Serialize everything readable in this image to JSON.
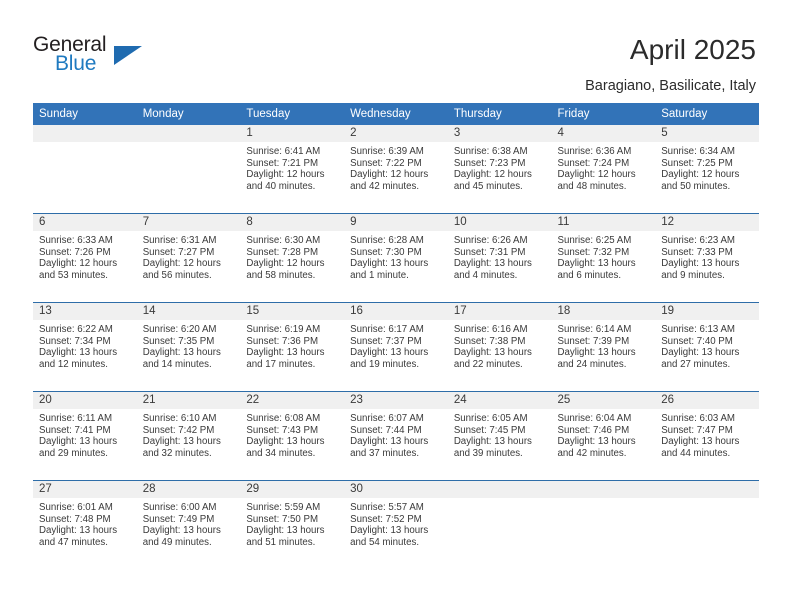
{
  "brand": {
    "word_one": "General",
    "word_two": "Blue",
    "triangle_icon": "triangle-logo-mark",
    "colors": {
      "dark": "#231f20",
      "blue": "#1f7ac0",
      "triangle": "#1f6bb0"
    }
  },
  "header": {
    "title": "April 2025",
    "subtitle": "Baragiano, Basilicate, Italy"
  },
  "theme": {
    "header_blue": "#3273b8",
    "row_divider_blue": "#2e6da8",
    "daynum_band_gray": "#f0f0f0",
    "text": "#3a3a3a"
  },
  "calendar": {
    "weekdays": [
      "Sunday",
      "Monday",
      "Tuesday",
      "Wednesday",
      "Thursday",
      "Friday",
      "Saturday"
    ],
    "labels": {
      "sunrise": "Sunrise:",
      "sunset": "Sunset:",
      "daylight": "Daylight:"
    },
    "weeks": [
      [
        {
          "day": "",
          "sunrise": "",
          "sunset": "",
          "daylight_a": "",
          "daylight_b": ""
        },
        {
          "day": "",
          "sunrise": "",
          "sunset": "",
          "daylight_a": "",
          "daylight_b": ""
        },
        {
          "day": "1",
          "sunrise": "Sunrise: 6:41 AM",
          "sunset": "Sunset: 7:21 PM",
          "daylight_a": "Daylight: 12 hours",
          "daylight_b": "and 40 minutes."
        },
        {
          "day": "2",
          "sunrise": "Sunrise: 6:39 AM",
          "sunset": "Sunset: 7:22 PM",
          "daylight_a": "Daylight: 12 hours",
          "daylight_b": "and 42 minutes."
        },
        {
          "day": "3",
          "sunrise": "Sunrise: 6:38 AM",
          "sunset": "Sunset: 7:23 PM",
          "daylight_a": "Daylight: 12 hours",
          "daylight_b": "and 45 minutes."
        },
        {
          "day": "4",
          "sunrise": "Sunrise: 6:36 AM",
          "sunset": "Sunset: 7:24 PM",
          "daylight_a": "Daylight: 12 hours",
          "daylight_b": "and 48 minutes."
        },
        {
          "day": "5",
          "sunrise": "Sunrise: 6:34 AM",
          "sunset": "Sunset: 7:25 PM",
          "daylight_a": "Daylight: 12 hours",
          "daylight_b": "and 50 minutes."
        }
      ],
      [
        {
          "day": "6",
          "sunrise": "Sunrise: 6:33 AM",
          "sunset": "Sunset: 7:26 PM",
          "daylight_a": "Daylight: 12 hours",
          "daylight_b": "and 53 minutes."
        },
        {
          "day": "7",
          "sunrise": "Sunrise: 6:31 AM",
          "sunset": "Sunset: 7:27 PM",
          "daylight_a": "Daylight: 12 hours",
          "daylight_b": "and 56 minutes."
        },
        {
          "day": "8",
          "sunrise": "Sunrise: 6:30 AM",
          "sunset": "Sunset: 7:28 PM",
          "daylight_a": "Daylight: 12 hours",
          "daylight_b": "and 58 minutes."
        },
        {
          "day": "9",
          "sunrise": "Sunrise: 6:28 AM",
          "sunset": "Sunset: 7:30 PM",
          "daylight_a": "Daylight: 13 hours",
          "daylight_b": "and 1 minute."
        },
        {
          "day": "10",
          "sunrise": "Sunrise: 6:26 AM",
          "sunset": "Sunset: 7:31 PM",
          "daylight_a": "Daylight: 13 hours",
          "daylight_b": "and 4 minutes."
        },
        {
          "day": "11",
          "sunrise": "Sunrise: 6:25 AM",
          "sunset": "Sunset: 7:32 PM",
          "daylight_a": "Daylight: 13 hours",
          "daylight_b": "and 6 minutes."
        },
        {
          "day": "12",
          "sunrise": "Sunrise: 6:23 AM",
          "sunset": "Sunset: 7:33 PM",
          "daylight_a": "Daylight: 13 hours",
          "daylight_b": "and 9 minutes."
        }
      ],
      [
        {
          "day": "13",
          "sunrise": "Sunrise: 6:22 AM",
          "sunset": "Sunset: 7:34 PM",
          "daylight_a": "Daylight: 13 hours",
          "daylight_b": "and 12 minutes."
        },
        {
          "day": "14",
          "sunrise": "Sunrise: 6:20 AM",
          "sunset": "Sunset: 7:35 PM",
          "daylight_a": "Daylight: 13 hours",
          "daylight_b": "and 14 minutes."
        },
        {
          "day": "15",
          "sunrise": "Sunrise: 6:19 AM",
          "sunset": "Sunset: 7:36 PM",
          "daylight_a": "Daylight: 13 hours",
          "daylight_b": "and 17 minutes."
        },
        {
          "day": "16",
          "sunrise": "Sunrise: 6:17 AM",
          "sunset": "Sunset: 7:37 PM",
          "daylight_a": "Daylight: 13 hours",
          "daylight_b": "and 19 minutes."
        },
        {
          "day": "17",
          "sunrise": "Sunrise: 6:16 AM",
          "sunset": "Sunset: 7:38 PM",
          "daylight_a": "Daylight: 13 hours",
          "daylight_b": "and 22 minutes."
        },
        {
          "day": "18",
          "sunrise": "Sunrise: 6:14 AM",
          "sunset": "Sunset: 7:39 PM",
          "daylight_a": "Daylight: 13 hours",
          "daylight_b": "and 24 minutes."
        },
        {
          "day": "19",
          "sunrise": "Sunrise: 6:13 AM",
          "sunset": "Sunset: 7:40 PM",
          "daylight_a": "Daylight: 13 hours",
          "daylight_b": "and 27 minutes."
        }
      ],
      [
        {
          "day": "20",
          "sunrise": "Sunrise: 6:11 AM",
          "sunset": "Sunset: 7:41 PM",
          "daylight_a": "Daylight: 13 hours",
          "daylight_b": "and 29 minutes."
        },
        {
          "day": "21",
          "sunrise": "Sunrise: 6:10 AM",
          "sunset": "Sunset: 7:42 PM",
          "daylight_a": "Daylight: 13 hours",
          "daylight_b": "and 32 minutes."
        },
        {
          "day": "22",
          "sunrise": "Sunrise: 6:08 AM",
          "sunset": "Sunset: 7:43 PM",
          "daylight_a": "Daylight: 13 hours",
          "daylight_b": "and 34 minutes."
        },
        {
          "day": "23",
          "sunrise": "Sunrise: 6:07 AM",
          "sunset": "Sunset: 7:44 PM",
          "daylight_a": "Daylight: 13 hours",
          "daylight_b": "and 37 minutes."
        },
        {
          "day": "24",
          "sunrise": "Sunrise: 6:05 AM",
          "sunset": "Sunset: 7:45 PM",
          "daylight_a": "Daylight: 13 hours",
          "daylight_b": "and 39 minutes."
        },
        {
          "day": "25",
          "sunrise": "Sunrise: 6:04 AM",
          "sunset": "Sunset: 7:46 PM",
          "daylight_a": "Daylight: 13 hours",
          "daylight_b": "and 42 minutes."
        },
        {
          "day": "26",
          "sunrise": "Sunrise: 6:03 AM",
          "sunset": "Sunset: 7:47 PM",
          "daylight_a": "Daylight: 13 hours",
          "daylight_b": "and 44 minutes."
        }
      ],
      [
        {
          "day": "27",
          "sunrise": "Sunrise: 6:01 AM",
          "sunset": "Sunset: 7:48 PM",
          "daylight_a": "Daylight: 13 hours",
          "daylight_b": "and 47 minutes."
        },
        {
          "day": "28",
          "sunrise": "Sunrise: 6:00 AM",
          "sunset": "Sunset: 7:49 PM",
          "daylight_a": "Daylight: 13 hours",
          "daylight_b": "and 49 minutes."
        },
        {
          "day": "29",
          "sunrise": "Sunrise: 5:59 AM",
          "sunset": "Sunset: 7:50 PM",
          "daylight_a": "Daylight: 13 hours",
          "daylight_b": "and 51 minutes."
        },
        {
          "day": "30",
          "sunrise": "Sunrise: 5:57 AM",
          "sunset": "Sunset: 7:52 PM",
          "daylight_a": "Daylight: 13 hours",
          "daylight_b": "and 54 minutes."
        },
        {
          "day": "",
          "sunrise": "",
          "sunset": "",
          "daylight_a": "",
          "daylight_b": ""
        },
        {
          "day": "",
          "sunrise": "",
          "sunset": "",
          "daylight_a": "",
          "daylight_b": ""
        },
        {
          "day": "",
          "sunrise": "",
          "sunset": "",
          "daylight_a": "",
          "daylight_b": ""
        }
      ]
    ]
  }
}
